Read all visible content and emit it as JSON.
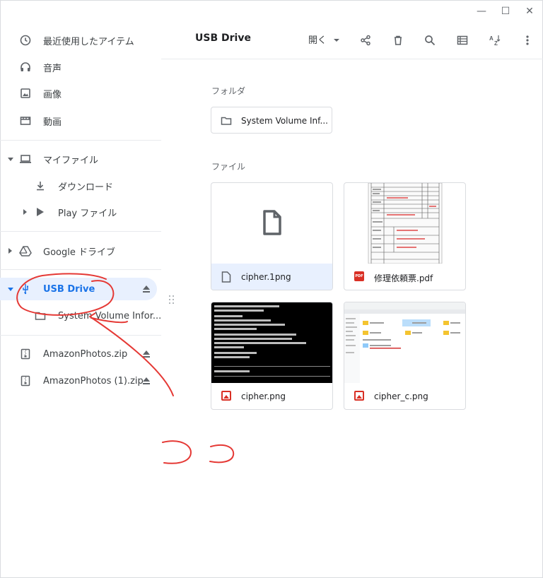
{
  "window": {
    "minimize": "—",
    "maximize": "☐",
    "close": "✕"
  },
  "sidebar": {
    "recent": "最近使用したアイテム",
    "audio": "音声",
    "images": "画像",
    "videos": "動画",
    "my_files": "マイファイル",
    "downloads": "ダウンロード",
    "play_files": "Play ファイル",
    "google_drive": "Google ドライブ",
    "usb_drive": "USB Drive",
    "system_volume": "System Volume Infor...",
    "zip1": "AmazonPhotos.zip",
    "zip2": "AmazonPhotos (1).zip"
  },
  "header": {
    "title": "USB Drive",
    "open_label": "開く"
  },
  "sections": {
    "folders": "フォルダ",
    "files": "ファイル"
  },
  "folders": [
    {
      "name": "System Volume Inf..."
    }
  ],
  "files": [
    {
      "name": "cipher.1png",
      "icon": "file-icon"
    },
    {
      "name": "修理依頼票.pdf",
      "icon": "pdf-icon"
    },
    {
      "name": "cipher.png",
      "icon": "image-icon"
    },
    {
      "name": "cipher_c.png",
      "icon": "image-icon"
    }
  ],
  "colors": {
    "accent": "#1a73e8",
    "selected_bg": "#e8f0fe",
    "annotation": "#e53935"
  }
}
